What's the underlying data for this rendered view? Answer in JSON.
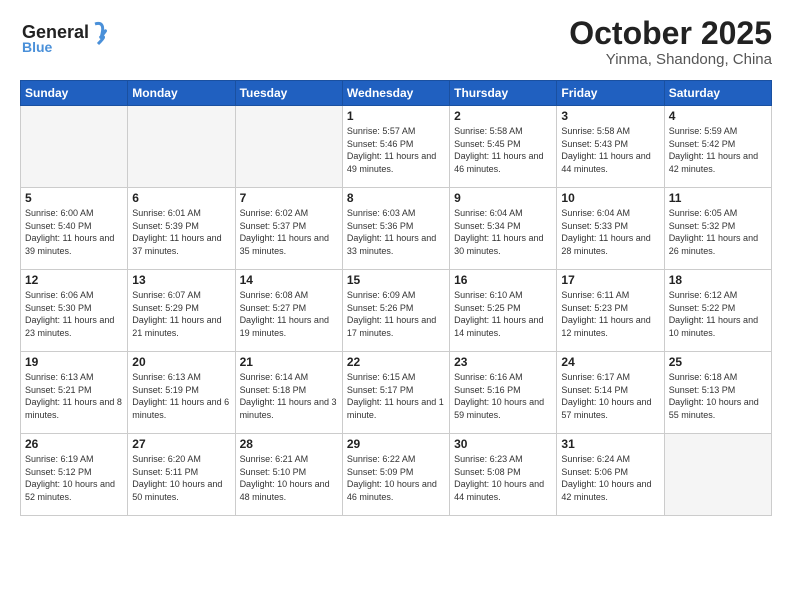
{
  "header": {
    "logo_general": "General",
    "logo_blue": "Blue",
    "month_title": "October 2025",
    "location": "Yinma, Shandong, China"
  },
  "days_of_week": [
    "Sunday",
    "Monday",
    "Tuesday",
    "Wednesday",
    "Thursday",
    "Friday",
    "Saturday"
  ],
  "weeks": [
    [
      {
        "day": "",
        "empty": true
      },
      {
        "day": "",
        "empty": true
      },
      {
        "day": "",
        "empty": true
      },
      {
        "day": "1",
        "sunrise": "5:57 AM",
        "sunset": "5:46 PM",
        "daylight": "11 hours and 49 minutes."
      },
      {
        "day": "2",
        "sunrise": "5:58 AM",
        "sunset": "5:45 PM",
        "daylight": "11 hours and 46 minutes."
      },
      {
        "day": "3",
        "sunrise": "5:58 AM",
        "sunset": "5:43 PM",
        "daylight": "11 hours and 44 minutes."
      },
      {
        "day": "4",
        "sunrise": "5:59 AM",
        "sunset": "5:42 PM",
        "daylight": "11 hours and 42 minutes."
      }
    ],
    [
      {
        "day": "5",
        "sunrise": "6:00 AM",
        "sunset": "5:40 PM",
        "daylight": "11 hours and 39 minutes."
      },
      {
        "day": "6",
        "sunrise": "6:01 AM",
        "sunset": "5:39 PM",
        "daylight": "11 hours and 37 minutes."
      },
      {
        "day": "7",
        "sunrise": "6:02 AM",
        "sunset": "5:37 PM",
        "daylight": "11 hours and 35 minutes."
      },
      {
        "day": "8",
        "sunrise": "6:03 AM",
        "sunset": "5:36 PM",
        "daylight": "11 hours and 33 minutes."
      },
      {
        "day": "9",
        "sunrise": "6:04 AM",
        "sunset": "5:34 PM",
        "daylight": "11 hours and 30 minutes."
      },
      {
        "day": "10",
        "sunrise": "6:04 AM",
        "sunset": "5:33 PM",
        "daylight": "11 hours and 28 minutes."
      },
      {
        "day": "11",
        "sunrise": "6:05 AM",
        "sunset": "5:32 PM",
        "daylight": "11 hours and 26 minutes."
      }
    ],
    [
      {
        "day": "12",
        "sunrise": "6:06 AM",
        "sunset": "5:30 PM",
        "daylight": "11 hours and 23 minutes."
      },
      {
        "day": "13",
        "sunrise": "6:07 AM",
        "sunset": "5:29 PM",
        "daylight": "11 hours and 21 minutes."
      },
      {
        "day": "14",
        "sunrise": "6:08 AM",
        "sunset": "5:27 PM",
        "daylight": "11 hours and 19 minutes."
      },
      {
        "day": "15",
        "sunrise": "6:09 AM",
        "sunset": "5:26 PM",
        "daylight": "11 hours and 17 minutes."
      },
      {
        "day": "16",
        "sunrise": "6:10 AM",
        "sunset": "5:25 PM",
        "daylight": "11 hours and 14 minutes."
      },
      {
        "day": "17",
        "sunrise": "6:11 AM",
        "sunset": "5:23 PM",
        "daylight": "11 hours and 12 minutes."
      },
      {
        "day": "18",
        "sunrise": "6:12 AM",
        "sunset": "5:22 PM",
        "daylight": "11 hours and 10 minutes."
      }
    ],
    [
      {
        "day": "19",
        "sunrise": "6:13 AM",
        "sunset": "5:21 PM",
        "daylight": "11 hours and 8 minutes."
      },
      {
        "day": "20",
        "sunrise": "6:13 AM",
        "sunset": "5:19 PM",
        "daylight": "11 hours and 6 minutes."
      },
      {
        "day": "21",
        "sunrise": "6:14 AM",
        "sunset": "5:18 PM",
        "daylight": "11 hours and 3 minutes."
      },
      {
        "day": "22",
        "sunrise": "6:15 AM",
        "sunset": "5:17 PM",
        "daylight": "11 hours and 1 minute."
      },
      {
        "day": "23",
        "sunrise": "6:16 AM",
        "sunset": "5:16 PM",
        "daylight": "10 hours and 59 minutes."
      },
      {
        "day": "24",
        "sunrise": "6:17 AM",
        "sunset": "5:14 PM",
        "daylight": "10 hours and 57 minutes."
      },
      {
        "day": "25",
        "sunrise": "6:18 AM",
        "sunset": "5:13 PM",
        "daylight": "10 hours and 55 minutes."
      }
    ],
    [
      {
        "day": "26",
        "sunrise": "6:19 AM",
        "sunset": "5:12 PM",
        "daylight": "10 hours and 52 minutes."
      },
      {
        "day": "27",
        "sunrise": "6:20 AM",
        "sunset": "5:11 PM",
        "daylight": "10 hours and 50 minutes."
      },
      {
        "day": "28",
        "sunrise": "6:21 AM",
        "sunset": "5:10 PM",
        "daylight": "10 hours and 48 minutes."
      },
      {
        "day": "29",
        "sunrise": "6:22 AM",
        "sunset": "5:09 PM",
        "daylight": "10 hours and 46 minutes."
      },
      {
        "day": "30",
        "sunrise": "6:23 AM",
        "sunset": "5:08 PM",
        "daylight": "10 hours and 44 minutes."
      },
      {
        "day": "31",
        "sunrise": "6:24 AM",
        "sunset": "5:06 PM",
        "daylight": "10 hours and 42 minutes."
      },
      {
        "day": "",
        "empty": true
      }
    ]
  ]
}
